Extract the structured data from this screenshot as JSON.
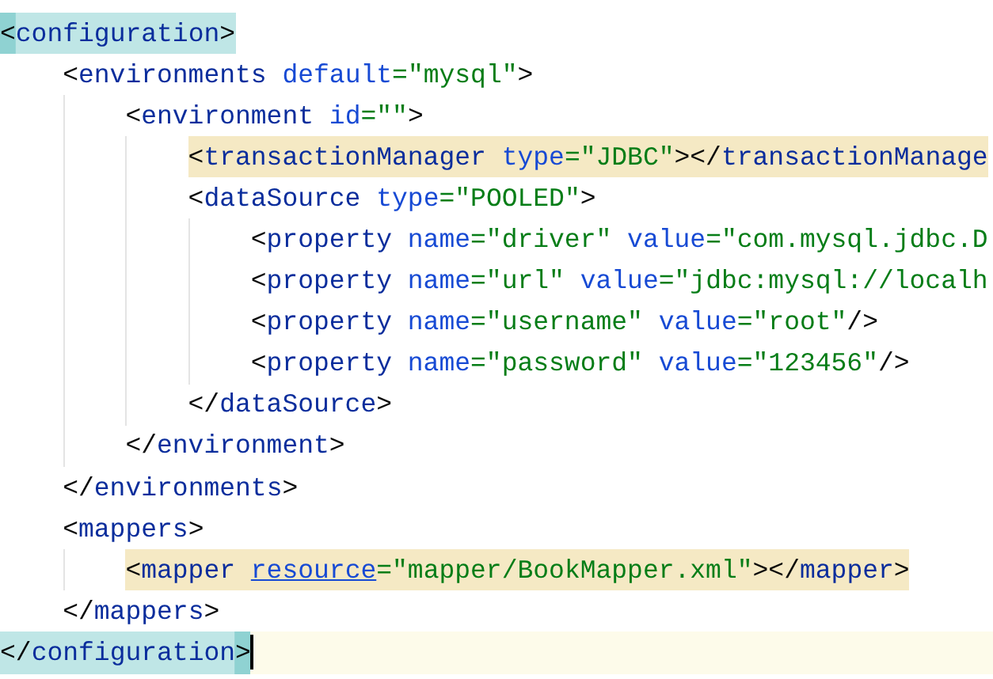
{
  "editor": {
    "lines": [
      {
        "kind": "match",
        "current": false,
        "tokens": [
          {
            "kind": "bracket",
            "text": "<"
          },
          {
            "kind": "tag",
            "text": "configuration"
          },
          {
            "kind": "bracket",
            "text": ">"
          }
        ],
        "children": [
          {
            "kind": "plain",
            "current": false,
            "tokens": [
              {
                "kind": "bracket",
                "text": "<"
              },
              {
                "kind": "tag",
                "text": "environments"
              },
              {
                "kind": "attr",
                "text": " default"
              },
              {
                "kind": "value",
                "text": "=\"mysql\""
              },
              {
                "kind": "bracket",
                "text": ">"
              }
            ],
            "children": [
              {
                "kind": "plain",
                "current": false,
                "tokens": [
                  {
                    "kind": "bracket",
                    "text": "<"
                  },
                  {
                    "kind": "tag",
                    "text": "environment"
                  },
                  {
                    "kind": "attr",
                    "text": " id"
                  },
                  {
                    "kind": "value",
                    "text": "=\"\""
                  },
                  {
                    "kind": "bracket",
                    "text": ">"
                  }
                ],
                "children": [
                  {
                    "kind": "tag",
                    "current": false,
                    "tokens": [
                      {
                        "kind": "bracket",
                        "text": "<"
                      },
                      {
                        "kind": "tag",
                        "text": "transactionManager"
                      },
                      {
                        "kind": "attr",
                        "text": " type"
                      },
                      {
                        "kind": "value",
                        "text": "=\"JDBC\""
                      },
                      {
                        "kind": "bracket",
                        "text": "></"
                      },
                      {
                        "kind": "tag",
                        "text": "transactionManage"
                      }
                    ]
                  },
                  {
                    "kind": "plain",
                    "current": false,
                    "tokens": [
                      {
                        "kind": "bracket",
                        "text": "<"
                      },
                      {
                        "kind": "tag",
                        "text": "dataSource"
                      },
                      {
                        "kind": "attr",
                        "text": " type"
                      },
                      {
                        "kind": "value",
                        "text": "=\"POOLED\""
                      },
                      {
                        "kind": "bracket",
                        "text": ">"
                      }
                    ],
                    "children": [
                      {
                        "kind": "plain",
                        "current": false,
                        "tokens": [
                          {
                            "kind": "bracket",
                            "text": "<"
                          },
                          {
                            "kind": "tag",
                            "text": "property"
                          },
                          {
                            "kind": "attr",
                            "text": " name"
                          },
                          {
                            "kind": "value",
                            "text": "=\"driver\""
                          },
                          {
                            "kind": "attr",
                            "text": " value"
                          },
                          {
                            "kind": "value",
                            "text": "=\"com.mysql.jdbc.D"
                          }
                        ]
                      },
                      {
                        "kind": "plain",
                        "current": false,
                        "tokens": [
                          {
                            "kind": "bracket",
                            "text": "<"
                          },
                          {
                            "kind": "tag",
                            "text": "property"
                          },
                          {
                            "kind": "attr",
                            "text": " name"
                          },
                          {
                            "kind": "value",
                            "text": "=\"url\""
                          },
                          {
                            "kind": "attr",
                            "text": " value"
                          },
                          {
                            "kind": "value",
                            "text": "=\"jdbc:mysql://localh"
                          }
                        ]
                      },
                      {
                        "kind": "plain",
                        "current": false,
                        "tokens": [
                          {
                            "kind": "bracket",
                            "text": "<"
                          },
                          {
                            "kind": "tag",
                            "text": "property"
                          },
                          {
                            "kind": "attr",
                            "text": " name"
                          },
                          {
                            "kind": "value",
                            "text": "=\"username\""
                          },
                          {
                            "kind": "attr",
                            "text": " value"
                          },
                          {
                            "kind": "value",
                            "text": "=\"root\""
                          },
                          {
                            "kind": "bracket",
                            "text": "/>"
                          }
                        ]
                      },
                      {
                        "kind": "plain",
                        "current": false,
                        "tokens": [
                          {
                            "kind": "bracket",
                            "text": "<"
                          },
                          {
                            "kind": "tag",
                            "text": "property"
                          },
                          {
                            "kind": "attr",
                            "text": " name"
                          },
                          {
                            "kind": "value",
                            "text": "=\"password\""
                          },
                          {
                            "kind": "attr",
                            "text": " value"
                          },
                          {
                            "kind": "value",
                            "text": "=\"123456\""
                          },
                          {
                            "kind": "bracket",
                            "text": "/>"
                          }
                        ]
                      }
                    ]
                  },
                  {
                    "kind": "plain",
                    "current": false,
                    "tokens": [
                      {
                        "kind": "bracket",
                        "text": "</"
                      },
                      {
                        "kind": "tag",
                        "text": "dataSource"
                      },
                      {
                        "kind": "bracket",
                        "text": ">"
                      }
                    ]
                  }
                ]
              },
              {
                "kind": "plain",
                "current": false,
                "tokens": [
                  {
                    "kind": "bracket",
                    "text": "</"
                  },
                  {
                    "kind": "tag",
                    "text": "environment"
                  },
                  {
                    "kind": "bracket",
                    "text": ">"
                  }
                ]
              }
            ]
          },
          {
            "kind": "plain",
            "current": false,
            "tokens": [
              {
                "kind": "bracket",
                "text": "</"
              },
              {
                "kind": "tag",
                "text": "environments"
              },
              {
                "kind": "bracket",
                "text": ">"
              }
            ]
          },
          {
            "kind": "plain",
            "current": false,
            "tokens": [
              {
                "kind": "bracket",
                "text": "<"
              },
              {
                "kind": "tag",
                "text": "mappers"
              },
              {
                "kind": "bracket",
                "text": ">"
              }
            ],
            "children": [
              {
                "kind": "tag",
                "current": false,
                "tokens": [
                  {
                    "kind": "bracket",
                    "text": "<"
                  },
                  {
                    "kind": "tag",
                    "text": "mapper "
                  },
                  {
                    "kind": "link",
                    "text": "resource"
                  },
                  {
                    "kind": "value",
                    "text": "=\"mapper/BookMapper.xml\""
                  },
                  {
                    "kind": "bracket",
                    "text": "></"
                  },
                  {
                    "kind": "tag",
                    "text": "mapper"
                  },
                  {
                    "kind": "bracket",
                    "text": ">"
                  }
                ]
              }
            ]
          },
          {
            "kind": "plain",
            "current": false,
            "tokens": [
              {
                "kind": "bracket",
                "text": "</"
              },
              {
                "kind": "tag",
                "text": "mappers"
              },
              {
                "kind": "bracket",
                "text": ">"
              }
            ]
          }
        ]
      },
      {
        "kind": "match",
        "current": true,
        "tokens": [
          {
            "kind": "bracket",
            "text": "</"
          },
          {
            "kind": "tag",
            "text": "configuration"
          },
          {
            "kind": "bracket",
            "text": ">"
          }
        ]
      }
    ]
  }
}
